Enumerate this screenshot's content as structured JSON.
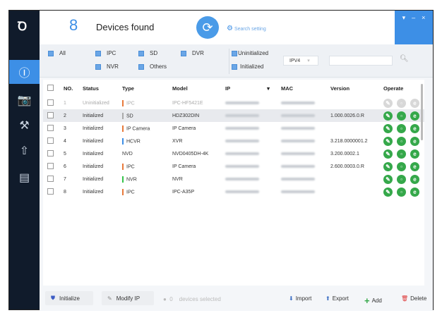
{
  "header": {
    "count": "8",
    "title": "Devices found",
    "search_setting": "Search setting"
  },
  "window_controls": {
    "menu": "▾",
    "minimize": "–",
    "close": "×"
  },
  "filters": {
    "types": [
      "All",
      "IPC",
      "SD",
      "DVR",
      "NVR",
      "Others"
    ],
    "status": [
      "Uninitialized",
      "Initialized"
    ],
    "ip_version": "IPV4",
    "search_value": ""
  },
  "table": {
    "columns": [
      "NO.",
      "Status",
      "Type",
      "Model",
      "IP",
      "MAC",
      "Version",
      "Operate"
    ],
    "rows": [
      {
        "no": "1",
        "status": "Uninitialized",
        "type": "IPC",
        "type_color": "#e8793a",
        "model": "IPC-HF5421E",
        "version": "",
        "enabled": false
      },
      {
        "no": "2",
        "status": "Initialized",
        "type": "SD",
        "type_color": "#aaaaaa",
        "model": "HDZ302DIN",
        "version": "1.000.0026.0.R",
        "enabled": true
      },
      {
        "no": "3",
        "status": "Initialized",
        "type": "IP Camera",
        "type_color": "#e8793a",
        "model": "IP Camera",
        "version": "",
        "enabled": true
      },
      {
        "no": "4",
        "status": "Initialized",
        "type": "HCVR",
        "type_color": "#3d8fe6",
        "model": "XVR",
        "version": "3.218.0000001.2",
        "enabled": true
      },
      {
        "no": "5",
        "status": "Initialized",
        "type": "NVD",
        "type_color": "",
        "model": "NVD0405DH-4K",
        "version": "3.200.0002.1",
        "enabled": true
      },
      {
        "no": "6",
        "status": "Initialized",
        "type": "IPC",
        "type_color": "#e8793a",
        "model": "IP Camera",
        "version": "2.600.0003.0.R",
        "enabled": true
      },
      {
        "no": "7",
        "status": "Initialized",
        "type": "NVR",
        "type_color": "#35c44a",
        "model": "NVR",
        "version": "",
        "enabled": true
      },
      {
        "no": "8",
        "status": "Initialized",
        "type": "IPC",
        "type_color": "#e8793a",
        "model": "IPC-A35P",
        "version": "",
        "enabled": true
      }
    ]
  },
  "bottom": {
    "initialize": "Initialize",
    "modify_ip": "Modify IP",
    "selected_count": "0",
    "selected_label": "devices selected",
    "import": "Import",
    "export": "Export",
    "add": "Add",
    "delete": "Delete"
  }
}
